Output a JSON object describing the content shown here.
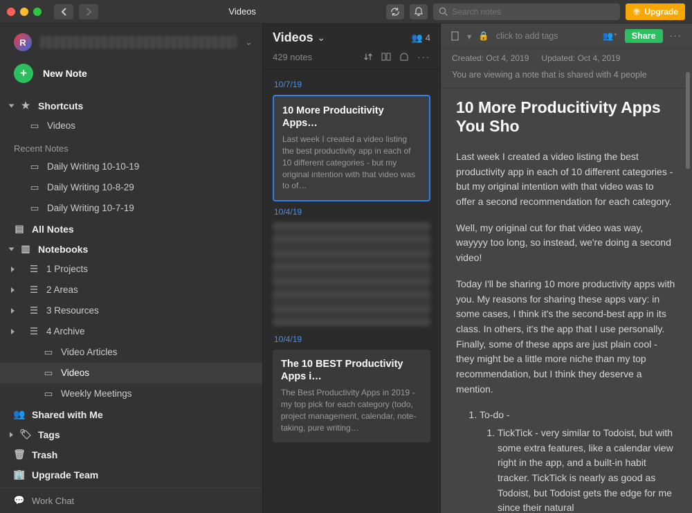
{
  "titlebar": {
    "title": "Videos",
    "search_placeholder": "Search notes",
    "upgrade_label": "Upgrade"
  },
  "sidebar": {
    "new_note_label": "New Note",
    "shortcuts_label": "Shortcuts",
    "shortcuts": {
      "0": {
        "label": "Videos"
      }
    },
    "recent_label": "Recent Notes",
    "recent": {
      "0": {
        "label": "Daily Writing 10-10-19"
      },
      "1": {
        "label": "Daily Writing 10-8-29"
      },
      "2": {
        "label": "Daily Writing 10-7-19"
      }
    },
    "all_notes_label": "All Notes",
    "notebooks_label": "Notebooks",
    "notebooks": {
      "0": {
        "label": "1 Projects"
      },
      "1": {
        "label": "2 Areas"
      },
      "2": {
        "label": "3 Resources"
      },
      "3": {
        "label": "4 Archive"
      },
      "4": {
        "label": "Video Articles"
      },
      "5": {
        "label": "Videos"
      },
      "6": {
        "label": "Weekly Meetings"
      }
    },
    "shared_label": "Shared with Me",
    "tags_label": "Tags",
    "trash_label": "Trash",
    "upgrade_team_label": "Upgrade Team",
    "work_chat_label": "Work Chat"
  },
  "notelist": {
    "title": "Videos",
    "people_count": "4",
    "count": "429 notes",
    "dates": {
      "0": "10/7/19",
      "1": "10/4/19",
      "2": "10/4/19"
    },
    "cards": {
      "0": {
        "title": "10 More Producitivity Apps…",
        "preview": "Last week I created a video listing the best productivity app in each of 10 different categories - but my original intention with that video was to of…"
      },
      "1": {
        "title": "The 10 BEST Productivity Apps i…",
        "preview": "The Best Productivity Apps in 2019 - my top pick for each category (todo, project management, calendar, note-taking, pure writing…"
      }
    }
  },
  "editor": {
    "tag_hint": "click to add tags",
    "share_label": "Share",
    "created": "Created: Oct 4, 2019",
    "updated": "Updated: Oct 4, 2019",
    "sharing_banner": "You are viewing a note that is shared with 4 people",
    "title": "10 More Producitivity Apps You Sho",
    "p1": "Last week I created a video listing the best productivity app in each of 10 different categories - but my original intention with that video was to offer a second recommendation for each category.",
    "p2": "Well, my original cut for that video was way, wayyyy too long, so instead, we're doing a second video!",
    "p3": "Today I'll be sharing 10 more productivity apps with you. My reasons for sharing these apps vary: in some cases, I think it's the second-best app in its class. In others, it's the app that I use personally. Finally, some of these apps are just plain cool - they might be a little more niche than my top recommendation, but I think they deserve a mention.",
    "list": {
      "top": "To-do -",
      "sub": "TickTick - very similar to Todoist, but with some extra features, like a calendar view right in the app, and a built-in habit tracker. TickTick is nearly as good as Todoist, but Todoist gets the edge for me since their natural"
    }
  }
}
